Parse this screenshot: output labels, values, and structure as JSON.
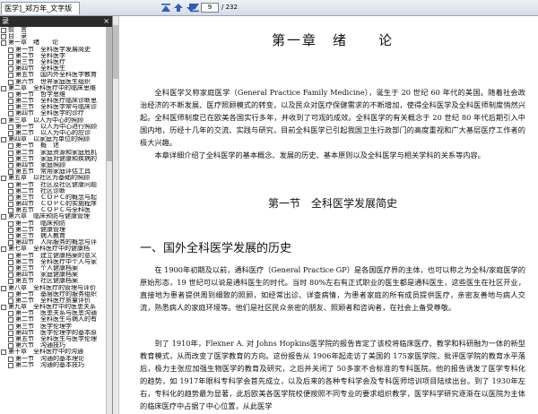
{
  "tab": {
    "title": "医学]_郑万年_文字版"
  },
  "toolbar": {
    "buttons": [
      {
        "name": "first-page-button",
        "icon": "first-page-icon"
      },
      {
        "name": "prev-page-button",
        "icon": "arrow-up-icon"
      },
      {
        "name": "next-page-button",
        "icon": "arrow-down-icon"
      },
      {
        "name": "last-page-button",
        "icon": "last-page-icon"
      }
    ],
    "page_current": "9",
    "page_total": "/ 232"
  },
  "sidebar": {
    "header": "录",
    "close": "×",
    "items": [
      {
        "level": 0,
        "label": "前　言"
      },
      {
        "level": 0,
        "label": "目　录"
      },
      {
        "level": 0,
        "label": "第一章　绪　　论"
      },
      {
        "level": 1,
        "label": "第一节　全科医学发展简史"
      },
      {
        "level": 1,
        "label": "第二节　全科医学"
      },
      {
        "level": 1,
        "label": "第三节　全科医疗"
      },
      {
        "level": 1,
        "label": "第四节　全科医生"
      },
      {
        "level": 1,
        "label": "第五节　国内外全科医学教育"
      },
      {
        "level": 1,
        "label": "第六节　世界家庭医生组织"
      },
      {
        "level": 0,
        "label": "第二章　全科医疗中的临床思维"
      },
      {
        "level": 1,
        "label": "第一节　哲学思维"
      },
      {
        "level": 1,
        "label": "第二节　全科医疗临床诊断思"
      },
      {
        "level": 1,
        "label": "第三节　全科医学常与临床诊"
      },
      {
        "level": 1,
        "label": "第四节　全科医学的诊疗"
      },
      {
        "level": 0,
        "label": "第三章　以人为中心的照顾"
      },
      {
        "level": 1,
        "label": "第一节　以人为中心进行照顾"
      },
      {
        "level": 1,
        "label": "第二节　以人为中心的应诊"
      },
      {
        "level": 0,
        "label": "第四章　以家庭为单位的照顾"
      },
      {
        "level": 1,
        "label": "第一节　概　述"
      },
      {
        "level": 1,
        "label": "第二节　家庭资源和家庭危机"
      },
      {
        "level": 1,
        "label": "第三节　家庭对健康和疾病的"
      },
      {
        "level": 1,
        "label": "第四节　家庭照顾"
      },
      {
        "level": 1,
        "label": "第五节　常用家庭评估工具"
      },
      {
        "level": 0,
        "label": "第五章　以社区为基础的照顾"
      },
      {
        "level": 1,
        "label": "第一节　社区及社区健康问题"
      },
      {
        "level": 1,
        "label": "第二节　社区诊断"
      },
      {
        "level": 1,
        "label": "第三节　ＣＯＰＣ的概念与起"
      },
      {
        "level": 1,
        "label": "第四节　ＣＯＰＣ的实施程序"
      },
      {
        "level": 1,
        "label": "第五节　ＣＯＰＣ与全科医"
      },
      {
        "level": 0,
        "label": "第六章　临床预防与健康管理"
      },
      {
        "level": 1,
        "label": "第一节　临床预防"
      },
      {
        "level": 1,
        "label": "第二节　健康管理"
      },
      {
        "level": 1,
        "label": "第三节　病人教育"
      },
      {
        "level": 1,
        "label": "第四节　人际服务的概念与评"
      },
      {
        "level": 0,
        "label": "第七章　全科医疗中的健康档"
      },
      {
        "level": 1,
        "label": "第一节　建立健康档案的意义"
      },
      {
        "level": 1,
        "label": "第二节　全科医疗中个人与家"
      },
      {
        "level": 1,
        "label": "第三节　个人健康档案"
      },
      {
        "level": 1,
        "label": "第四节　家庭健康档案"
      },
      {
        "level": 1,
        "label": "第五节　社区健康档案"
      },
      {
        "level": 0,
        "label": "第八章　全科医疗的管理与评价"
      },
      {
        "level": 1,
        "label": "第一节　基层医疗的服务组织"
      },
      {
        "level": 1,
        "label": "第二节　全科医疗质量评价"
      },
      {
        "level": 0,
        "label": "第九章　全科医疗中的医患关系"
      },
      {
        "level": 1,
        "label": "第一节　医患关系与医患沟通"
      },
      {
        "level": 1,
        "label": "第二节　全科医生与病人的有"
      },
      {
        "level": 1,
        "label": "第三节　医学伦理学"
      },
      {
        "level": 1,
        "label": "第四节　医学伦理学的基本原"
      },
      {
        "level": 1,
        "label": "第五节　全科医生与医学伦理"
      },
      {
        "level": 1,
        "label": "第六节　沟通技巧"
      },
      {
        "level": 0,
        "label": "第十章　全科医疗中的沟通"
      },
      {
        "level": 1,
        "label": "第一节　沟通的基本理论"
      },
      {
        "level": 1,
        "label": "第二节　沟通的基本技巧"
      }
    ]
  },
  "document": {
    "chapter_title": "第一章　绪　　论",
    "para1": "全科医学又称家庭医学（General Practice Family Medicine），诞生于 20 世纪 60 年代的美国。随着社会政治经济的不断发展、医疗照顾模式的转变，以及民众对医疗保健需求的不断增加，使得全科医学及全科医师制度悄然兴起。全科医师制度已在欧美各国实行多年，并收到了可观的成效。全科医学的有关概念于 20 世纪 80 年代后期引入中国内地，历经十几年的交流、实践与研究，目前全科医学已引起我国卫生行政部门的高度重视和广大基层医疗工作者的极大兴趣。",
    "para2": "本章详细介绍了全科医学的基本概念、发展的历史、基本原则以及全科医学与相关学科的关系等内容。",
    "section_title": "第一节　全科医学发展简史",
    "subheading": "一、国外全科医学发展的历史",
    "para3": "在 1900年初期及以前，通科医疗（General Practice GP）是各国医疗界的主体，也可以称之为全科/家庭医学的原始形态，19 世纪可以说是通科医生的时代。当时 80%左右有正式职业的医生都是通科医生，这些医生在社区开业，直接地为患者提供周到细致的照顾，如经常出诊、详查病情，为患者家庭的所有成员提供医疗，亲密友善地与病人交流，熟悉病人的家庭环境等。他们是社区民众亲密的朋友、照顾者和咨询者，在社会上备受尊敬。",
    "para4": "到了 1910年，Flexner A. 对 Johns Hopkins医学院的报告肯定了该校将临床医疗、教学和科研融为一体的新型教育模式，从而改变了医学教育的方向。这份报告从 1906年起走访了美国的 175家医学院，批评医学院的教育水平落后，极力主张应加强生物医学的教育及研究，之后并关闭了 50多家不合标准的专科医院。他的报告诱发了医学专科化的趋势，如 1917年眼科专科学会首先成立，以及后来的各种专科学会及专科医师培训项目陆续出台。到了 1930年左右，专科化的趋势最为显著，此后欧美各医学院校便按照不同专业的要求组织教学，医学科学研究逐渐在以医院为主体的临床医疗中占据了中心位置，从此医学"
  }
}
